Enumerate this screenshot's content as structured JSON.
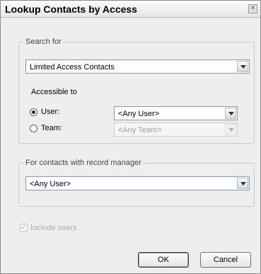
{
  "dialog": {
    "title": "Lookup Contacts by Access",
    "close_glyph": "×"
  },
  "search_for": {
    "legend": "Search for",
    "selected": "Limited Access Contacts",
    "accessible_to_label": "Accessible to",
    "user_label": "User:",
    "user_selected": "<Any User>",
    "team_label": "Team:",
    "team_selected": "<Any Team>"
  },
  "record_manager": {
    "legend": "For contacts with record manager",
    "selected": "<Any User>"
  },
  "include_users": {
    "label": "Include users",
    "check_glyph": "✓"
  },
  "buttons": {
    "ok": "OK",
    "cancel": "Cancel"
  }
}
